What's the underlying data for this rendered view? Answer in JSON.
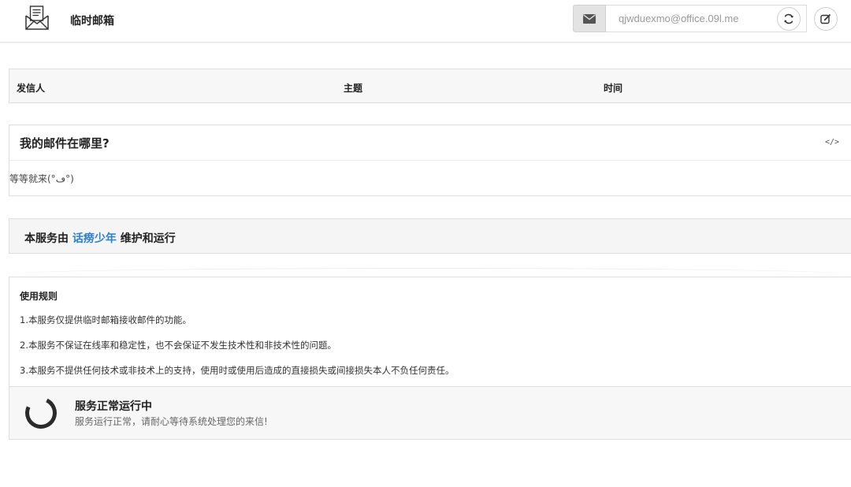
{
  "header": {
    "title": "临时邮箱",
    "email": "qjwduexmo@office.09l.me"
  },
  "table": {
    "columns": [
      "发信人",
      "主题",
      "时间"
    ]
  },
  "where_panel": {
    "title": "我的邮件在哪里?",
    "code_icon": "</>",
    "body": "等等就来(°ڡ°)"
  },
  "service": {
    "prefix": "本服务由 ",
    "link": "话痨少年",
    "suffix": " 维护和运行",
    "link_color": "#2f81cc"
  },
  "rules": {
    "title": "使用规则",
    "items": [
      "1.本服务仅提供临时邮箱接收邮件的功能。",
      "2.本服务不保证在线率和稳定性，也不会保证不发生技术性和非技术性的问题。",
      "3.本服务不提供任何技术或非技术上的支持，使用时或使用后造成的直接损失或间接损失本人不负任何责任。"
    ]
  },
  "status": {
    "title": "服务正常运行中",
    "description": "服务运行正常，请耐心等待系统处理您的来信!"
  },
  "icons": {
    "logo": "mail-envelope-icon",
    "mail": "envelope-icon",
    "refresh": "refresh-icon",
    "edit": "edit-icon",
    "code": "code-icon",
    "spinner": "loading-spinner-icon"
  }
}
